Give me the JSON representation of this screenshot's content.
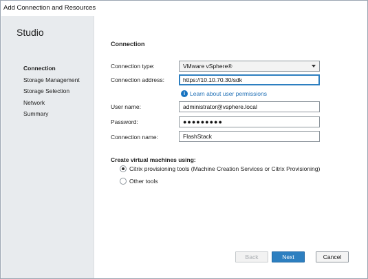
{
  "window": {
    "title": "Add Connection and Resources"
  },
  "sidebar": {
    "title": "Studio",
    "steps": [
      "Connection",
      "Storage Management",
      "Storage Selection",
      "Network",
      "Summary"
    ],
    "active_step": "Connection"
  },
  "page": {
    "heading": "Connection",
    "connection_type": {
      "label": "Connection type:",
      "value": "VMware vSphere®"
    },
    "connection_address": {
      "label": "Connection address:",
      "value": "https://10.10.70.30/sdk"
    },
    "permissions_link": "Learn about user permissions",
    "user_name": {
      "label": "User name:",
      "value": "administrator@vsphere.local"
    },
    "password": {
      "label": "Password:",
      "value": "●●●●●●●●●"
    },
    "connection_name": {
      "label": "Connection name:",
      "value": "FlashStack"
    },
    "create_vms": {
      "label": "Create virtual machines using:",
      "options": [
        {
          "label": "Citrix provisioning tools (Machine Creation Services or Citrix Provisioning)",
          "checked": true
        },
        {
          "label": "Other tools",
          "checked": false
        }
      ]
    }
  },
  "footer": {
    "back": "Back",
    "next": "Next",
    "cancel": "Cancel"
  },
  "colors": {
    "accent": "#2d7fc0",
    "link": "#1f6fb5",
    "sidebar_bg": "#e8ebee"
  }
}
